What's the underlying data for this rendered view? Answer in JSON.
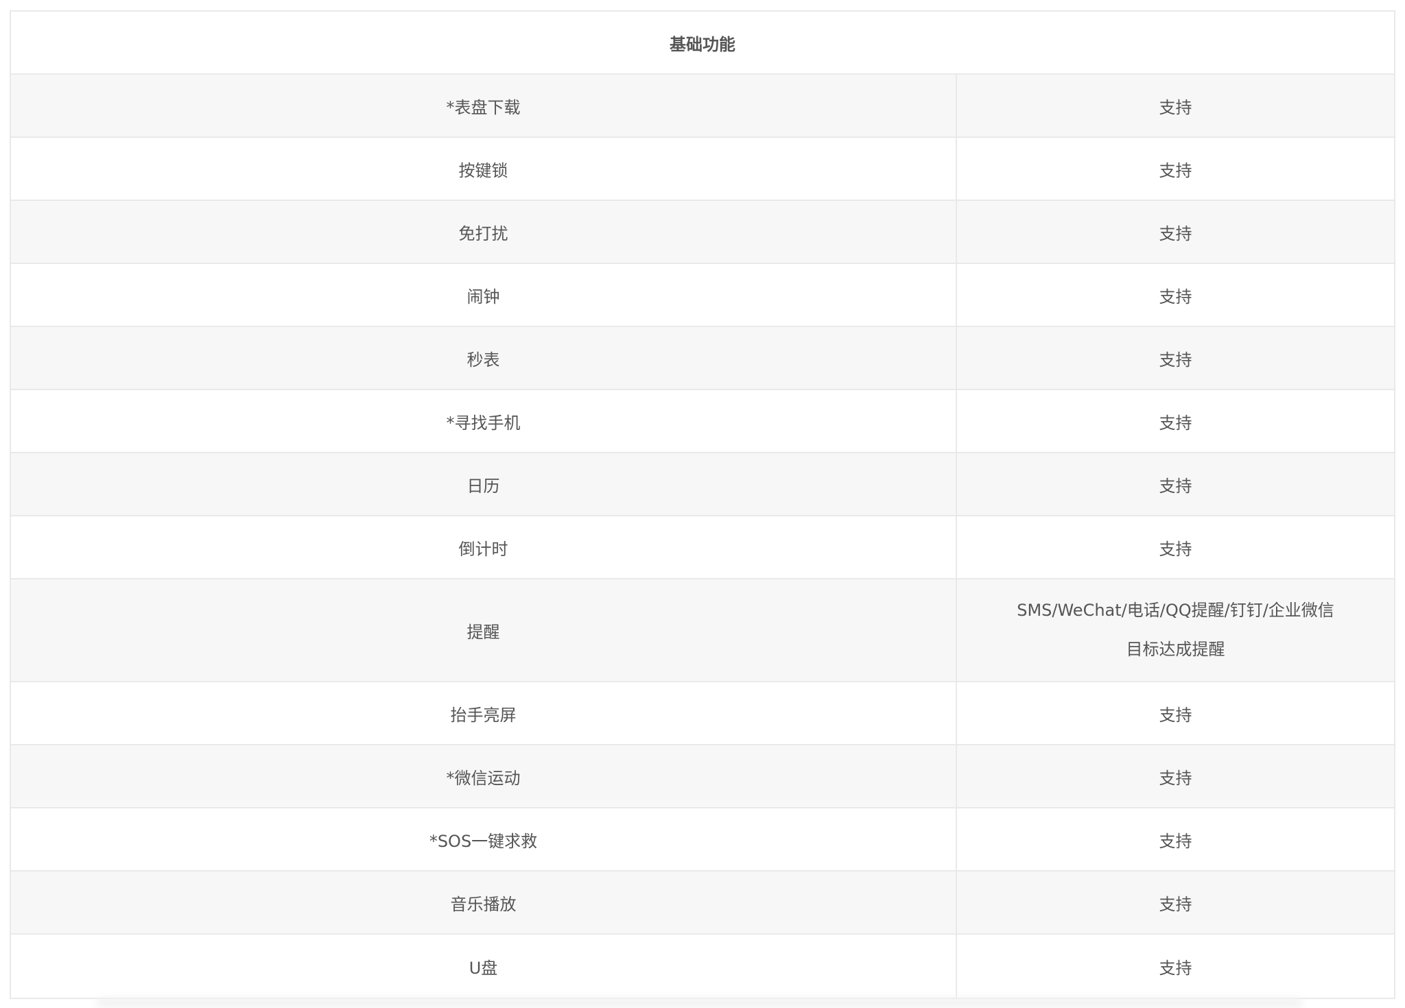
{
  "table": {
    "header": "基础功能",
    "rows": [
      {
        "name": "*表盘下载",
        "values": [
          "支持"
        ]
      },
      {
        "name": "按键锁",
        "values": [
          "支持"
        ]
      },
      {
        "name": "免打扰",
        "values": [
          "支持"
        ]
      },
      {
        "name": "闹钟",
        "values": [
          "支持"
        ]
      },
      {
        "name": "秒表",
        "values": [
          "支持"
        ]
      },
      {
        "name": "*寻找手机",
        "values": [
          "支持"
        ]
      },
      {
        "name": "日历",
        "values": [
          "支持"
        ]
      },
      {
        "name": "倒计时",
        "values": [
          "支持"
        ]
      },
      {
        "name": "提醒",
        "values": [
          "SMS/WeChat/电话/QQ提醒/钉钉/企业微信",
          "目标达成提醒"
        ]
      },
      {
        "name": "抬手亮屏",
        "values": [
          "支持"
        ]
      },
      {
        "name": "*微信运动",
        "values": [
          "支持"
        ]
      },
      {
        "name": "*SOS一键求救",
        "values": [
          "支持"
        ]
      },
      {
        "name": "音乐播放",
        "values": [
          "支持"
        ]
      },
      {
        "name": "U盘",
        "values": [
          "支持"
        ]
      }
    ]
  }
}
